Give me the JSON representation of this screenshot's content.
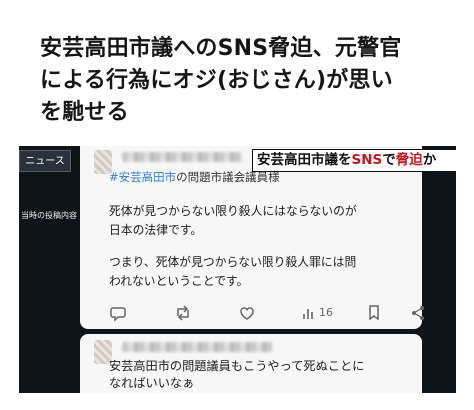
{
  "headline": {
    "line1": "安芸高田市議へのSNS脅迫、元警官",
    "line2": "による行為にオジ(おじさん)が思い",
    "line3": "を馳せる"
  },
  "video": {
    "news_label": "ニュース",
    "side_caption": "当時の投稿内容",
    "banner": {
      "part1": "安芸高田市議を",
      "part2": "SNS",
      "part3": "で",
      "part4": "脅迫",
      "part5": "か"
    },
    "post": {
      "hashtag": "#安芸高田市",
      "hashtag_rest": "の問題市議会議員様",
      "line1": "死体が見つからない限り殺人にはならないのが",
      "line2": "日本の法律です。",
      "line3": "つまり、死体が見つからない限り殺人罪には問",
      "line4": "われないということです。",
      "views": "16"
    },
    "reply": {
      "line1": "安芸高田市の問題議員もこうやって死ぬことに",
      "line2": "なればいいなぁ"
    }
  },
  "colors": {
    "accent_red": "#c4161c",
    "hashtag_blue": "#2a7fd4",
    "video_bg": "#0f1418"
  },
  "icons": [
    "reply-icon",
    "repost-icon",
    "like-icon",
    "views-icon",
    "bookmark-icon",
    "share-icon"
  ]
}
